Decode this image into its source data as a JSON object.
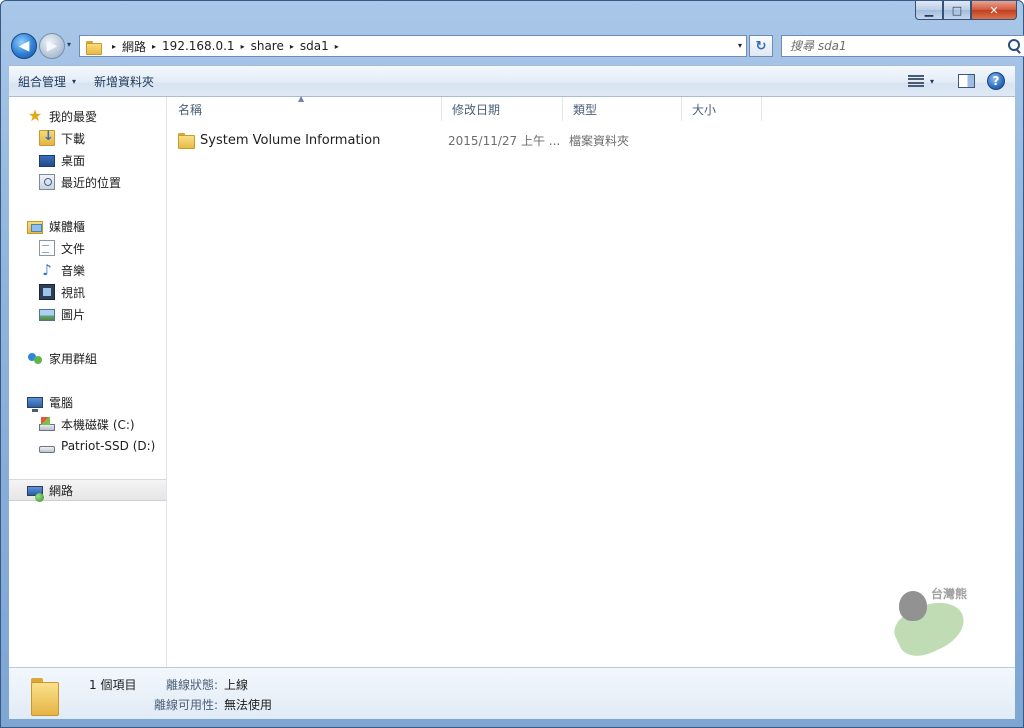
{
  "caption": {
    "minimize_glyph": "▁",
    "maximize_glyph": "□",
    "close_glyph": "✕"
  },
  "address_bar": {
    "breadcrumbs": [
      "網路",
      "192.168.0.1",
      "share",
      "sda1"
    ],
    "separator_glyph": "▸",
    "dropdown_glyph": "▾",
    "refresh_glyph": "↻"
  },
  "search": {
    "placeholder": "搜尋 sda1"
  },
  "command_bar": {
    "organize_label": "組合管理",
    "organize_arrow": "▾",
    "new_folder_label": "新增資料夾",
    "views_arrow": "▾",
    "help_glyph": "?"
  },
  "nav_pane": {
    "favorites": {
      "label": "我的最愛",
      "items": [
        {
          "label": "下載",
          "icon": "download-icon"
        },
        {
          "label": "桌面",
          "icon": "desktop-icon"
        },
        {
          "label": "最近的位置",
          "icon": "recent-icon"
        }
      ]
    },
    "libraries": {
      "label": "媒體櫃",
      "items": [
        {
          "label": "文件",
          "icon": "document-icon"
        },
        {
          "label": "音樂",
          "icon": "music-icon"
        },
        {
          "label": "視訊",
          "icon": "video-icon"
        },
        {
          "label": "圖片",
          "icon": "picture-icon"
        }
      ]
    },
    "homegroup": {
      "label": "家用群組"
    },
    "computer": {
      "label": "電腦",
      "items": [
        {
          "label": "本機磁碟 (C:)",
          "icon": "drive-c-icon"
        },
        {
          "label": "Patriot-SSD (D:)",
          "icon": "drive-d-icon"
        }
      ]
    },
    "network": {
      "label": "網路",
      "selected": true
    }
  },
  "columns": {
    "name": "名稱",
    "date_modified": "修改日期",
    "type": "類型",
    "size": "大小",
    "sort_glyph": "▲"
  },
  "files": [
    {
      "name": "System Volume Information",
      "date_modified": "2015/11/27 上午 ...",
      "type": "檔案資料夾",
      "size": ""
    }
  ],
  "watermark": {
    "text": "台灣熊"
  },
  "details": {
    "item_count": "1 個項目",
    "offline_status_label": "離線狀態:",
    "offline_status_value": "上線",
    "offline_availability_label": "離線可用性:",
    "offline_availability_value": "無法使用"
  }
}
